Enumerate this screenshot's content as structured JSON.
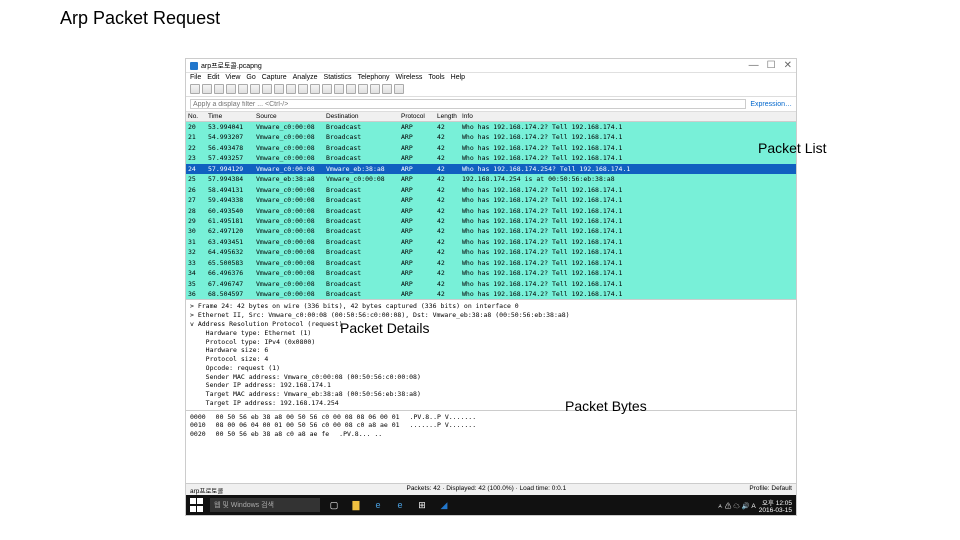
{
  "slide_title": "Arp Packet Request",
  "annotations": {
    "list": "Packet List",
    "details": "Packet Details",
    "bytes": "Packet Bytes"
  },
  "window": {
    "title": "arp프로토콜.pcapng",
    "controls": {
      "min": "—",
      "max": "☐",
      "close": "✕"
    }
  },
  "menu": [
    "File",
    "Edit",
    "View",
    "Go",
    "Capture",
    "Analyze",
    "Statistics",
    "Telephony",
    "Wireless",
    "Tools",
    "Help"
  ],
  "filter_placeholder": "Apply a display filter ... <Ctrl-/>",
  "expression_label": "Expression…",
  "columns": {
    "no": "No.",
    "time": "Time",
    "src": "Source",
    "dst": "Destination",
    "proto": "Protocol",
    "len": "Length",
    "info": "Info"
  },
  "packets": [
    {
      "no": "20",
      "time": "53.994041",
      "src": "Vmware_c0:00:08",
      "dst": "Broadcast",
      "proto": "ARP",
      "len": "42",
      "info": "Who has 192.168.174.2? Tell 192.168.174.1"
    },
    {
      "no": "21",
      "time": "54.993207",
      "src": "Vmware_c0:00:08",
      "dst": "Broadcast",
      "proto": "ARP",
      "len": "42",
      "info": "Who has 192.168.174.2? Tell 192.168.174.1"
    },
    {
      "no": "22",
      "time": "56.493478",
      "src": "Vmware_c0:00:08",
      "dst": "Broadcast",
      "proto": "ARP",
      "len": "42",
      "info": "Who has 192.168.174.2? Tell 192.168.174.1"
    },
    {
      "no": "23",
      "time": "57.493257",
      "src": "Vmware_c0:00:08",
      "dst": "Broadcast",
      "proto": "ARP",
      "len": "42",
      "info": "Who has 192.168.174.2? Tell 192.168.174.1"
    },
    {
      "no": "24",
      "time": "57.994129",
      "src": "Vmware_c0:00:08",
      "dst": "Vmware_eb:38:a8",
      "proto": "ARP",
      "len": "42",
      "info": "Who has 192.168.174.254? Tell 192.168.174.1",
      "selected": true
    },
    {
      "no": "25",
      "time": "57.994384",
      "src": "Vmware_eb:38:a8",
      "dst": "Vmware_c0:00:08",
      "proto": "ARP",
      "len": "42",
      "info": "192.168.174.254 is at 00:50:56:eb:38:a8"
    },
    {
      "no": "26",
      "time": "58.494131",
      "src": "Vmware_c0:00:08",
      "dst": "Broadcast",
      "proto": "ARP",
      "len": "42",
      "info": "Who has 192.168.174.2? Tell 192.168.174.1"
    },
    {
      "no": "27",
      "time": "59.494338",
      "src": "Vmware_c0:00:08",
      "dst": "Broadcast",
      "proto": "ARP",
      "len": "42",
      "info": "Who has 192.168.174.2? Tell 192.168.174.1"
    },
    {
      "no": "28",
      "time": "60.493540",
      "src": "Vmware_c0:00:08",
      "dst": "Broadcast",
      "proto": "ARP",
      "len": "42",
      "info": "Who has 192.168.174.2? Tell 192.168.174.1"
    },
    {
      "no": "29",
      "time": "61.495181",
      "src": "Vmware_c0:00:08",
      "dst": "Broadcast",
      "proto": "ARP",
      "len": "42",
      "info": "Who has 192.168.174.2? Tell 192.168.174.1"
    },
    {
      "no": "30",
      "time": "62.497120",
      "src": "Vmware_c0:00:08",
      "dst": "Broadcast",
      "proto": "ARP",
      "len": "42",
      "info": "Who has 192.168.174.2? Tell 192.168.174.1"
    },
    {
      "no": "31",
      "time": "63.493451",
      "src": "Vmware_c0:00:08",
      "dst": "Broadcast",
      "proto": "ARP",
      "len": "42",
      "info": "Who has 192.168.174.2? Tell 192.168.174.1"
    },
    {
      "no": "32",
      "time": "64.495632",
      "src": "Vmware_c0:00:08",
      "dst": "Broadcast",
      "proto": "ARP",
      "len": "42",
      "info": "Who has 192.168.174.2? Tell 192.168.174.1"
    },
    {
      "no": "33",
      "time": "65.500583",
      "src": "Vmware_c0:00:08",
      "dst": "Broadcast",
      "proto": "ARP",
      "len": "42",
      "info": "Who has 192.168.174.2? Tell 192.168.174.1"
    },
    {
      "no": "34",
      "time": "66.496376",
      "src": "Vmware_c0:00:08",
      "dst": "Broadcast",
      "proto": "ARP",
      "len": "42",
      "info": "Who has 192.168.174.2? Tell 192.168.174.1"
    },
    {
      "no": "35",
      "time": "67.496747",
      "src": "Vmware_c0:00:08",
      "dst": "Broadcast",
      "proto": "ARP",
      "len": "42",
      "info": "Who has 192.168.174.2? Tell 192.168.174.1"
    },
    {
      "no": "36",
      "time": "68.504597",
      "src": "Vmware_c0:00:08",
      "dst": "Broadcast",
      "proto": "ARP",
      "len": "42",
      "info": "Who has 192.168.174.2? Tell 192.168.174.1"
    }
  ],
  "details": [
    "> Frame 24: 42 bytes on wire (336 bits), 42 bytes captured (336 bits) on interface 0",
    "> Ethernet II, Src: Vmware_c0:00:08 (00:50:56:c0:00:08), Dst: Vmware_eb:38:a8 (00:50:56:eb:38:a8)",
    "v Address Resolution Protocol (request)",
    "    Hardware type: Ethernet (1)",
    "    Protocol type: IPv4 (0x0800)",
    "    Hardware size: 6",
    "    Protocol size: 4",
    "    Opcode: request (1)",
    "    Sender MAC address: Vmware_c0:00:08 (00:50:56:c0:00:08)",
    "    Sender IP address: 192.168.174.1",
    "    Target MAC address: Vmware_eb:38:a8 (00:50:56:eb:38:a8)",
    "    Target IP address: 192.168.174.254"
  ],
  "bytes": [
    {
      "off": "0000",
      "hex": "00 50 56 eb 38 a8 00 50  56 c0 00 08 08 06 00 01",
      "ascii": ".PV.8..P V......."
    },
    {
      "off": "0010",
      "hex": "08 00 06 04 00 01 00 50  56 c0 00 08 c0 a8 ae 01",
      "ascii": ".......P V......."
    },
    {
      "off": "0020",
      "hex": "00 50 56 eb 38 a8 c0 a8  ae fe",
      "ascii": ".PV.8... .."
    }
  ],
  "status": {
    "left": "arp프로토콜",
    "center": "Packets: 42 · Displayed: 42 (100.0%) · Load time: 0:0.1",
    "right": "Profile: Default"
  },
  "taskbar": {
    "search": "웹 및 Windows 검색",
    "time": "오후 12:05",
    "date": "2016-03-15"
  }
}
